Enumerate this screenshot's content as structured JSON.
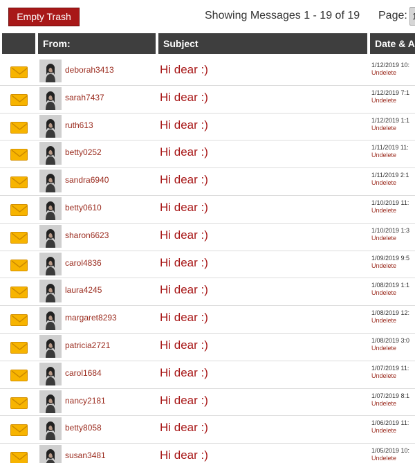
{
  "toolbar": {
    "empty_trash_label": "Empty Trash",
    "showing_text": "Showing Messages 1 - 19 of 19",
    "page_label": "Page:",
    "page_value": "1",
    "envelope_icon": "envelope-icon",
    "avatar_icon": "avatar-photo"
  },
  "table": {
    "headers": [
      "",
      "From:",
      "Subject",
      "Date & Actions"
    ],
    "rows": [
      {
        "from": "deborah3413",
        "subject": "Hi dear :)",
        "date": "1/12/2019 10:",
        "action": "Undelete"
      },
      {
        "from": "sarah7437",
        "subject": "Hi dear :)",
        "date": "1/12/2019 7:1",
        "action": "Undelete"
      },
      {
        "from": "ruth613",
        "subject": "Hi dear :)",
        "date": "1/12/2019 1:1",
        "action": "Undelete"
      },
      {
        "from": "betty0252",
        "subject": "Hi dear :)",
        "date": "1/11/2019 11:",
        "action": "Undelete"
      },
      {
        "from": "sandra6940",
        "subject": "Hi dear :)",
        "date": "1/11/2019 2:1",
        "action": "Undelete"
      },
      {
        "from": "betty0610",
        "subject": "Hi dear :)",
        "date": "1/10/2019 11:",
        "action": "Undelete"
      },
      {
        "from": "sharon6623",
        "subject": "Hi dear :)",
        "date": "1/10/2019 1:3",
        "action": "Undelete"
      },
      {
        "from": "carol4836",
        "subject": "Hi dear :)",
        "date": "1/09/2019 9:5",
        "action": "Undelete"
      },
      {
        "from": "laura4245",
        "subject": "Hi dear :)",
        "date": "1/08/2019 1:1",
        "action": "Undelete"
      },
      {
        "from": "margaret8293",
        "subject": "Hi dear :)",
        "date": "1/08/2019 12:",
        "action": "Undelete"
      },
      {
        "from": "patricia2721",
        "subject": "Hi dear :)",
        "date": "1/08/2019 3:0",
        "action": "Undelete"
      },
      {
        "from": "carol1684",
        "subject": "Hi dear :)",
        "date": "1/07/2019 11:",
        "action": "Undelete"
      },
      {
        "from": "nancy2181",
        "subject": "Hi dear :)",
        "date": "1/07/2019 8:1",
        "action": "Undelete"
      },
      {
        "from": "betty8058",
        "subject": "Hi dear :)",
        "date": "1/06/2019 11:",
        "action": "Undelete"
      },
      {
        "from": "susan3481",
        "subject": "Hi dear :)",
        "date": "1/05/2019 10:",
        "action": "Undelete"
      }
    ]
  },
  "colors": {
    "button_red": "#a81818",
    "header_bg": "#3e3e3e",
    "link_red": "#9a2a1d",
    "envelope_yellow": "#f7b400"
  }
}
